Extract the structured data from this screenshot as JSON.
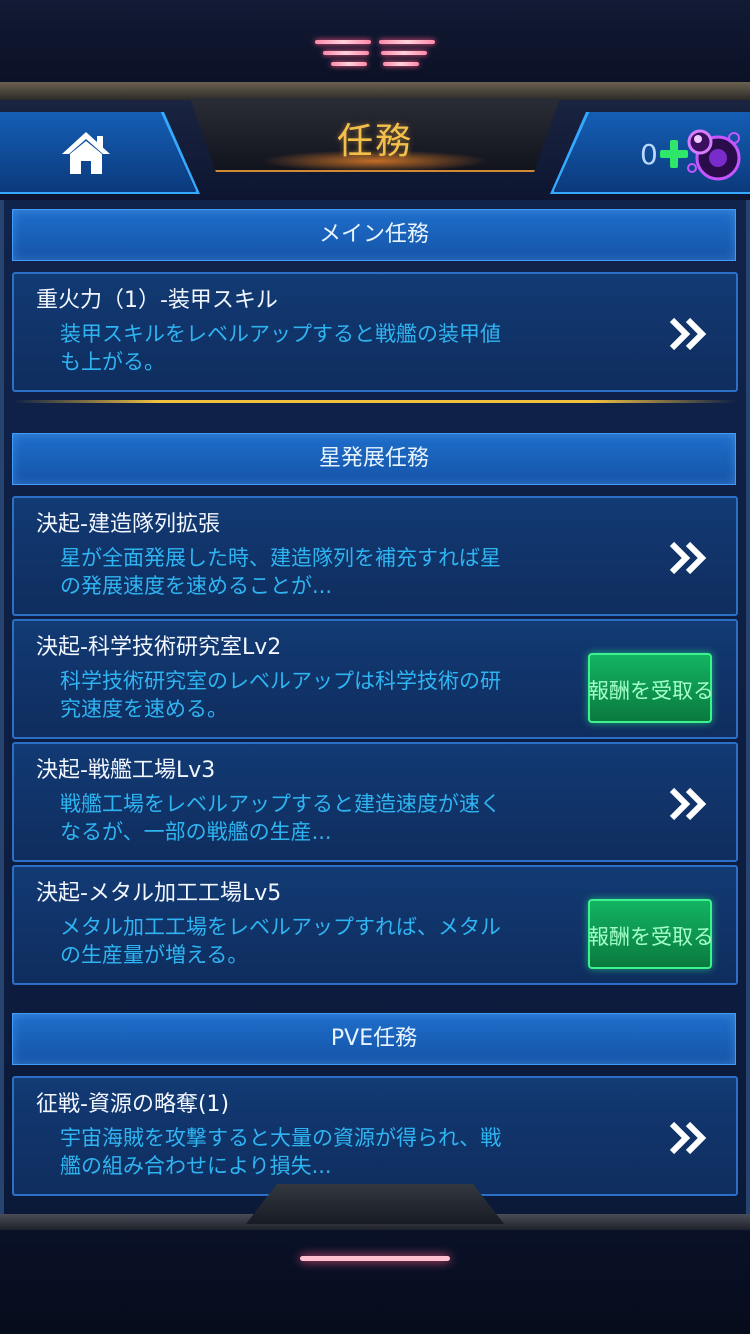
{
  "header": {
    "title": "任務",
    "resource_count": "0"
  },
  "sections": [
    {
      "label": "メイン任務",
      "tasks": [
        {
          "title": "重火力（1）-装甲スキル",
          "desc_lines": [
            "装甲スキルをレベルアップすると戦艦の装甲値",
            "も上がる。"
          ],
          "action": "arrow"
        }
      ]
    },
    {
      "label": "星発展任務",
      "tasks": [
        {
          "title": "決起-建造隊列拡張",
          "desc_lines": [
            "星が全面発展した時、建造隊列を補充すれば星",
            "の発展速度を速めることが..."
          ],
          "action": "arrow"
        },
        {
          "title": "決起-科学技術研究室Lv2",
          "desc_lines": [
            "科学技術研究室のレベルアップは科学技術の研",
            "究速度を速める。"
          ],
          "action": "claim",
          "action_label": "報酬を受取る"
        },
        {
          "title": "決起-戦艦工場Lv3",
          "desc_lines": [
            "戦艦工場をレベルアップすると建造速度が速く",
            "なるが、一部の戦艦の生産..."
          ],
          "action": "arrow"
        },
        {
          "title": "決起-メタル加工工場Lv5",
          "desc_lines": [
            "メタル加工工場をレベルアップすれば、メタル",
            "の生産量が増える。"
          ],
          "action": "claim",
          "action_label": "報酬を受取る"
        }
      ]
    },
    {
      "label": "PVE任務",
      "tasks": [
        {
          "title": "征戦-資源の略奪(1)",
          "desc_lines": [
            "宇宙海賊を攻撃すると大量の資源が得られ、戦",
            "艦の組み合わせにより損失..."
          ],
          "action": "arrow"
        }
      ]
    }
  ],
  "colors": {
    "title_gold": "#f4c04c",
    "desc_cyan": "#2fb4f2",
    "claim_green": "#12b462",
    "panel_blue": "#1e6ecb"
  },
  "icons": [
    "menu-icon",
    "home-icon",
    "add-icon",
    "crystal-icon",
    "double-chevron-right-icon"
  ]
}
